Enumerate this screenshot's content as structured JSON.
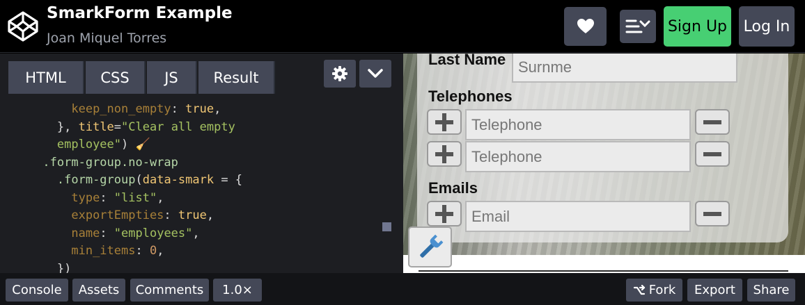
{
  "header": {
    "title": "SmarkForm Example",
    "author": "Joan Miquel Torres",
    "signup_label": "Sign Up",
    "login_label": "Log In",
    "icons": [
      "codepen-logo-icon",
      "heart-icon",
      "layout-menu-icon"
    ]
  },
  "editor": {
    "tabs": [
      {
        "label": "HTML"
      },
      {
        "label": "CSS"
      },
      {
        "label": "JS"
      },
      {
        "label": "Result"
      }
    ],
    "icons": [
      "gear-icon",
      "chevron-down-icon"
    ],
    "code": {
      "line1": {
        "indent": "          ",
        "key": "keep_non_empty",
        "sep": ": ",
        "val": "true",
        "end": ","
      },
      "line2": {
        "indent": "        ",
        "a": "}, ",
        "key": "title",
        "eq": "=",
        "str": "\"Clear all empty"
      },
      "line3": {
        "indent": "        ",
        "str": "employee\"",
        "end": ") ",
        "emoji": "🧹"
      },
      "line4": {
        "indent": "      ",
        "sel": ".form-group.no-wrap"
      },
      "line5": {
        "indent": "        ",
        "sel": ".form-group",
        "open": "(",
        "key": "data-smark",
        "eq": " = {"
      },
      "line6": {
        "indent": "          ",
        "key": "type",
        "sep": ": ",
        "str": "\"list\"",
        "end": ","
      },
      "line7": {
        "indent": "          ",
        "key": "exportEmpties",
        "sep": ": ",
        "val": "true",
        "end": ","
      },
      "line8": {
        "indent": "          ",
        "key": "name",
        "sep": ": ",
        "str": "\"employees\"",
        "end": ","
      },
      "line9": {
        "indent": "          ",
        "key": "min_items",
        "sep": ": ",
        "num": "0",
        "end": ","
      },
      "line10": {
        "indent": "        ",
        "end": "})"
      }
    }
  },
  "result": {
    "last_name_label": "Last Name",
    "last_name_placeholder": "Surnme",
    "telephones_label": "Telephones",
    "telephone_placeholder": "Telephone",
    "emails_label": "Emails",
    "email_placeholder": "Email",
    "icons": [
      "plus-icon",
      "minus-icon",
      "wrench-icon"
    ]
  },
  "footer": {
    "console_label": "Console",
    "assets_label": "Assets",
    "comments_label": "Comments",
    "zoom_label": "1.0×",
    "fork_label": "Fork",
    "export_label": "Export",
    "share_label": "Share",
    "icons": [
      "fork-icon"
    ]
  },
  "colors": {
    "signup_green": "#47cf73",
    "button_gray": "#444857",
    "editor_bg": "#1d1e22"
  }
}
